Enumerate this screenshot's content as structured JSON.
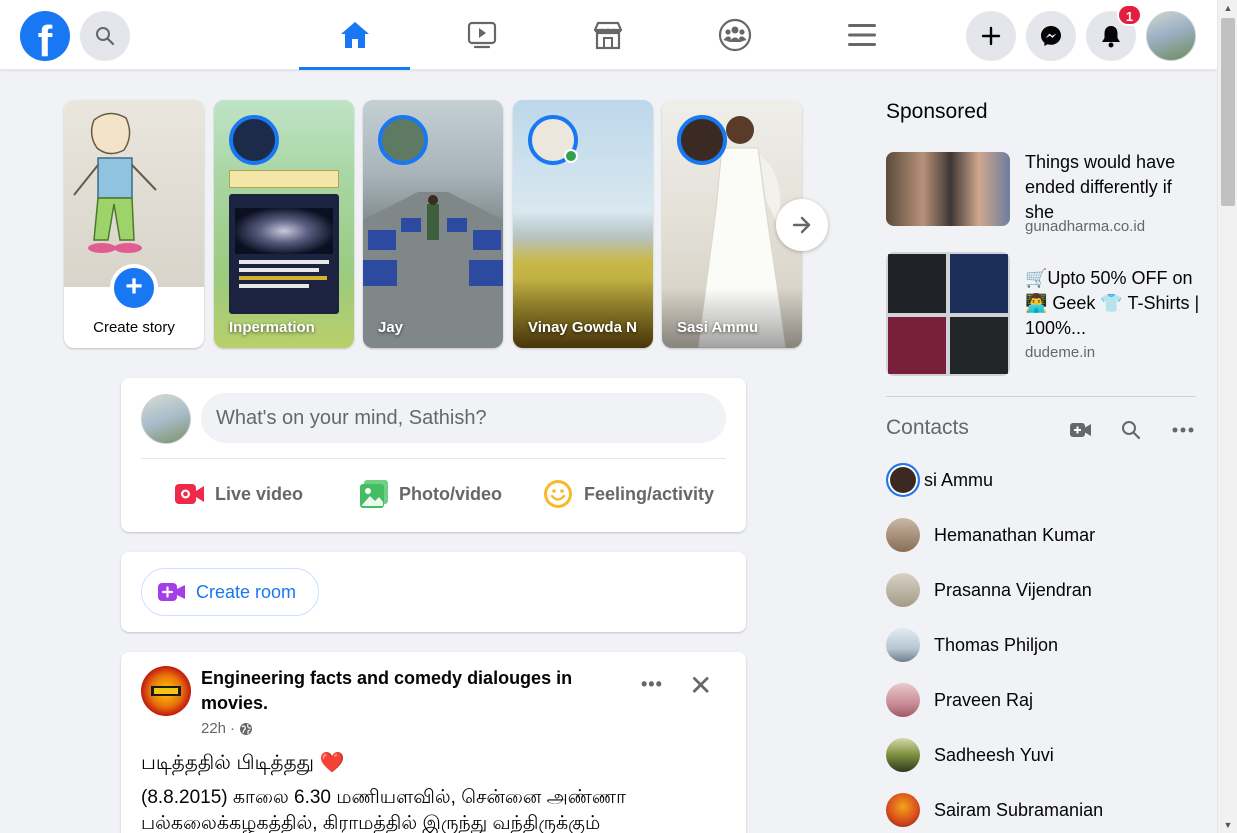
{
  "header": {
    "logo_letter": "f",
    "notification_count": "1",
    "nav": [
      {
        "id": "home",
        "icon": "home-icon",
        "active": true
      },
      {
        "id": "watch",
        "icon": "video-play-icon",
        "active": false
      },
      {
        "id": "marketplace",
        "icon": "marketplace-icon",
        "active": false
      },
      {
        "id": "groups",
        "icon": "groups-icon",
        "active": false
      },
      {
        "id": "menu",
        "icon": "hamburger-menu-icon",
        "active": false
      }
    ],
    "actions": [
      "plus-icon",
      "messenger-icon",
      "bell-icon"
    ]
  },
  "stories": {
    "create_label": "Create story",
    "items": [
      {
        "name": "Inpermation"
      },
      {
        "name": "Jay"
      },
      {
        "name": "Vinay Gowda N"
      },
      {
        "name": "Sasi Ammu"
      }
    ],
    "next_icon": "arrow-right-icon"
  },
  "composer": {
    "placeholder": "What's on your mind, Sathish?",
    "actions": [
      {
        "label": "Live video",
        "color": "#f02849"
      },
      {
        "label": "Photo/video",
        "color": "#45bd62"
      },
      {
        "label": "Feeling/activity",
        "color": "#f7b928"
      }
    ]
  },
  "rooms": {
    "create_room_label": "Create room",
    "color": "#1877f2"
  },
  "post": {
    "author": "Engineering facts and comedy dialouges in movies.",
    "time": "22h",
    "more": "•••",
    "close": "✕",
    "text_line1": "படித்ததில் பிடித்தது",
    "heart": "❤️",
    "text_line2": "(8.8.2015) காலை 6.30 மணியளவில், சென்னை அண்ணா பல்கலைக்கழகத்தில், கிராமத்தில் இருந்து வந்திருக்கும்"
  },
  "sponsored": {
    "title": "Sponsored",
    "ads": [
      {
        "headline": "Things would have ended differently if she",
        "domain": "gunadharma.co.id"
      },
      {
        "headline": "🛒Upto 50% OFF on 👨‍💻 Geek 👕 T-Shirts | 100%...",
        "domain": "dudeme.in"
      }
    ]
  },
  "contacts": {
    "title": "Contacts",
    "items": [
      {
        "name": "Sasi Ammu",
        "visible_text": "si Ammu"
      },
      {
        "name": "Hemanathan Kumar"
      },
      {
        "name": "Prasanna Vijendran"
      },
      {
        "name": "Thomas Philjon"
      },
      {
        "name": "Praveen Raj"
      },
      {
        "name": "Sadheesh Yuvi"
      },
      {
        "name": "Sairam Subramanian"
      }
    ]
  },
  "colors": {
    "brand": "#1877f2",
    "badge": "#e41e3f",
    "online": "#31a24c"
  }
}
